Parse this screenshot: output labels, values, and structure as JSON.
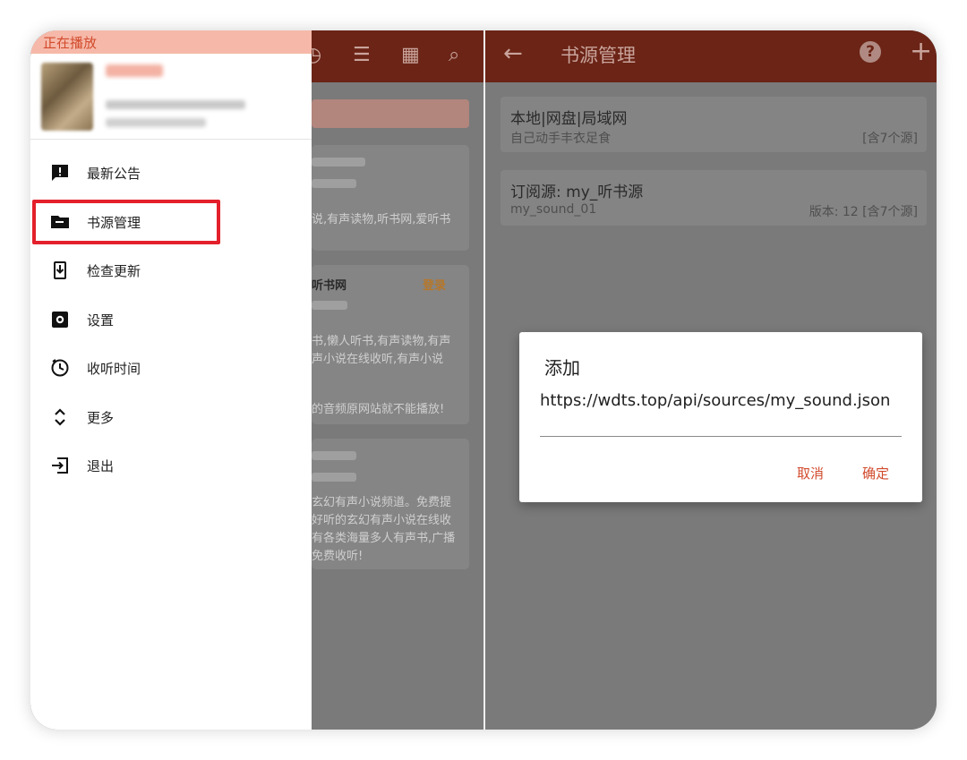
{
  "drawer": {
    "now_playing": "正在播放",
    "items": [
      {
        "label": "最新公告",
        "icon": "announcement-icon"
      },
      {
        "label": "书源管理",
        "icon": "folder-icon"
      },
      {
        "label": "检查更新",
        "icon": "download-update-icon"
      },
      {
        "label": "设置",
        "icon": "gear-icon"
      },
      {
        "label": "收听时间",
        "icon": "timer-icon"
      },
      {
        "label": "更多",
        "icon": "expand-icon"
      },
      {
        "label": "退出",
        "icon": "exit-icon"
      }
    ]
  },
  "left_bg": {
    "login_label": "登录",
    "texts": [
      "说,有声读物,听书网,爱听书",
      "听书网",
      "书,懒人听书,有声读物,有声",
      "声小说在线收听,有声小说",
      "的音频原网站就不能播放!",
      "玄幻有声小说频道。免费提",
      "好听的玄幻有声小说在线收",
      "有各类海量多人有声书,广播",
      "免费收听!"
    ]
  },
  "book_sources": {
    "title": "书源管理",
    "sources": [
      {
        "title": "本地|网盘|局域网",
        "subtitle": "自己动手丰衣足食",
        "version": "",
        "count": "[含7个源]"
      },
      {
        "title": "订阅源: my_听书源",
        "subtitle": "my_sound_01",
        "version": "版本: 12",
        "count": "[含7个源]"
      }
    ]
  },
  "dialog": {
    "title": "添加",
    "url_value": "https://wdts.top/api/sources/my_sound.json",
    "cancel_label": "取消",
    "confirm_label": "确定"
  },
  "colors": {
    "appbar": "#6b2416",
    "accent": "#d24a2c",
    "highlight": "#e3202b",
    "now_playing_bg": "#f6b9a9"
  }
}
